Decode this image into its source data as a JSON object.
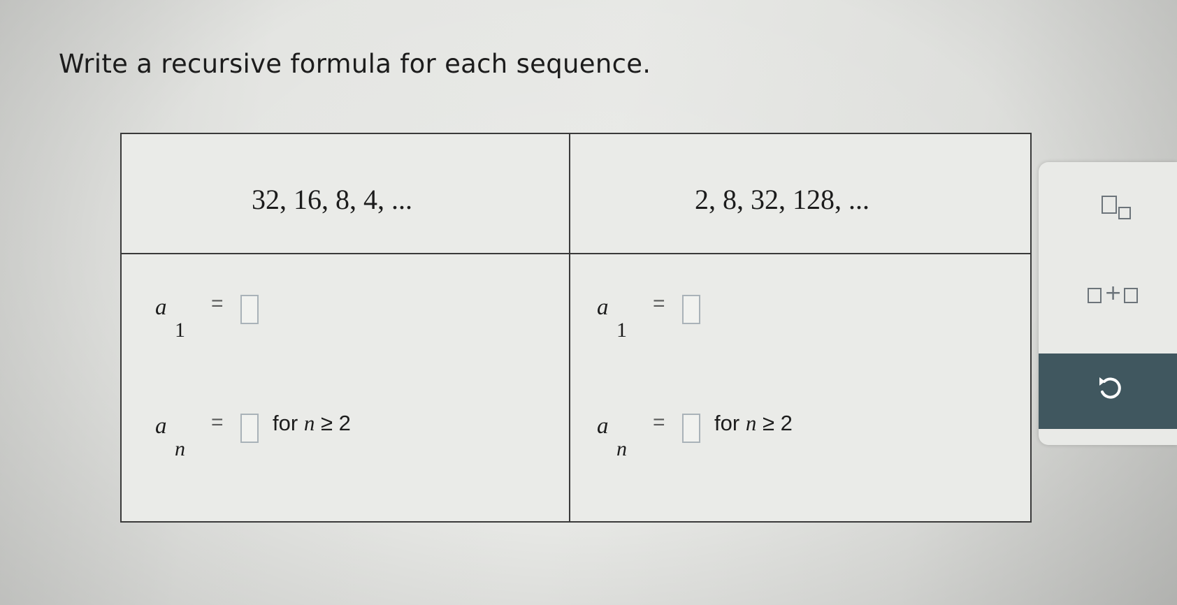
{
  "instruction": "Write a recursive formula for each sequence.",
  "table": {
    "columns": [
      {
        "sequence": "32, 16, 8, 4, ...",
        "first_term": {
          "variable": "a",
          "subscript": "1",
          "equals": "=",
          "value": ""
        },
        "recursive_term": {
          "variable": "a",
          "subscript": "n",
          "equals": "=",
          "value": "",
          "condition_for": "for",
          "condition_var": "n",
          "condition_rest": "≥ 2"
        }
      },
      {
        "sequence": "2, 8, 32, 128, ...",
        "first_term": {
          "variable": "a",
          "subscript": "1",
          "equals": "=",
          "value": ""
        },
        "recursive_term": {
          "variable": "a",
          "subscript": "n",
          "equals": "=",
          "value": "",
          "condition_for": "for",
          "condition_var": "n",
          "condition_rest": "≥ 2"
        }
      }
    ]
  },
  "tools": {
    "subscript_icon": "subscript-template-icon",
    "addition_icon": "addition-template-icon",
    "undo_icon": "undo-icon"
  },
  "colors": {
    "undo_background": "#40575f",
    "input_border": "#a9b2b8",
    "table_border": "#3a3a3a"
  }
}
